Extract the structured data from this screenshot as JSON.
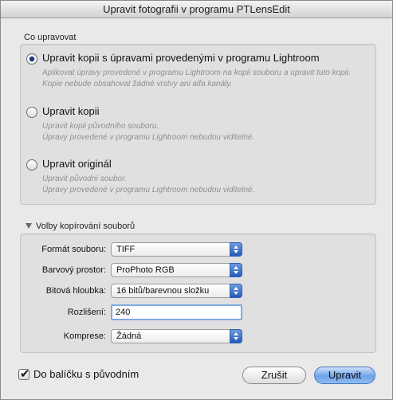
{
  "window": {
    "title": "Upravit fotografii v programu PTLensEdit"
  },
  "edit_group": {
    "label": "Co upravovat",
    "options": [
      {
        "title": "Upravit kopii s úpravami provedenými v programu Lightroom",
        "desc1": "Aplikovat úpravy provedené v programu Lightroom na kopii souboru a upravit tuto kopii.",
        "desc2": "Kopie nebude obsahovat žádné vrstvy ani alfa kanály.",
        "selected": true
      },
      {
        "title": "Upravit kopii",
        "desc1": "Upravit kopii původního souboru.",
        "desc2": "Úpravy provedené v programu Lightroom nebudou viditelné.",
        "selected": false
      },
      {
        "title": "Upravit originál",
        "desc1": "Upravit původní soubor.",
        "desc2": "Úpravy provedené v programu Lightroom nebudou viditelné.",
        "selected": false
      }
    ]
  },
  "copy_options": {
    "label": "Volby kopírování souborů",
    "format": {
      "label": "Formát souboru:",
      "value": "TIFF"
    },
    "color_space": {
      "label": "Barvový prostor:",
      "value": "ProPhoto RGB"
    },
    "bit_depth": {
      "label": "Bitová hloubka:",
      "value": "16 bitů/barevnou složku"
    },
    "resolution": {
      "label": "Rozlišení:",
      "value": "240"
    },
    "compression": {
      "label": "Komprese:",
      "value": "Žádná"
    }
  },
  "footer": {
    "stack_label": "Do balíčku s původním",
    "stack_checked": true,
    "cancel_label": "Zrušit",
    "edit_label": "Upravit"
  },
  "colors": {
    "accent": "#2559b8",
    "default_button": "#6ea3e8"
  }
}
